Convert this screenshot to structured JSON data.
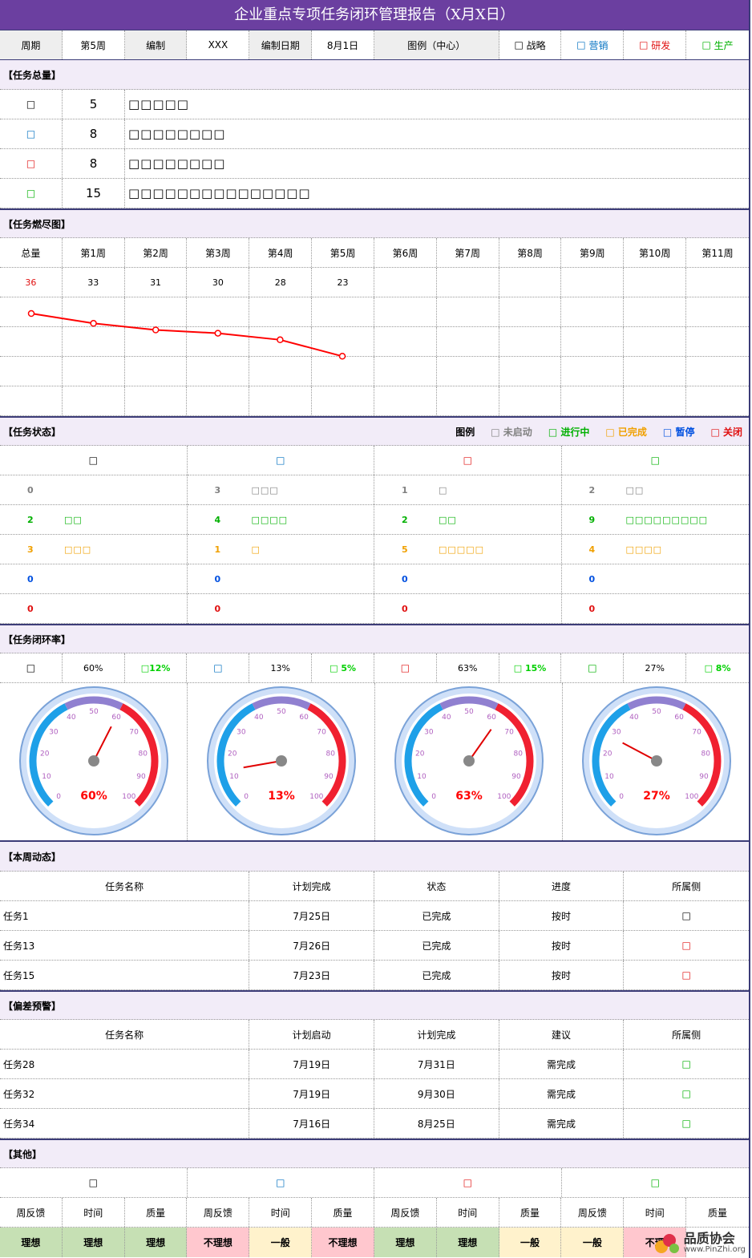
{
  "title": "企业重点专项任务闭环管理报告（X月X日）",
  "header": {
    "period_label": "周期",
    "period_value": "第5周",
    "editor_label": "编制",
    "editor_value": "XXX",
    "date_label": "编制日期",
    "date_value": "8月1日",
    "legend_label": "图例（中心）",
    "legend": [
      {
        "sym": "□",
        "text": "战略",
        "color": "#000000"
      },
      {
        "sym": "□",
        "text": "营销",
        "color": "#0070c0"
      },
      {
        "sym": "□",
        "text": "研发",
        "color": "#e01010"
      },
      {
        "sym": "□",
        "text": "生产",
        "color": "#00b000"
      }
    ]
  },
  "sections": {
    "total": "【任务总量】",
    "burndown": "【任务燃尽图】",
    "status": "【任务状态】",
    "closure": "【任务闭环率】",
    "weekly": "【本周动态】",
    "deviation": "【偏差预警】",
    "other": "【其他】"
  },
  "totals": [
    {
      "sym": "□",
      "count": "5",
      "boxes": "□□□□□"
    },
    {
      "sym": "□",
      "count": "8",
      "boxes": "□□□□□□□□"
    },
    {
      "sym": "□",
      "count": "8",
      "boxes": "□□□□□□□□"
    },
    {
      "sym": "□",
      "count": "15",
      "boxes": "□□□□□□□□□□□□□□□"
    }
  ],
  "burndown": {
    "headers": [
      "总量",
      "第1周",
      "第2周",
      "第3周",
      "第4周",
      "第5周",
      "第6周",
      "第7周",
      "第8周",
      "第9周",
      "第10周",
      "第11周"
    ],
    "values": [
      "36",
      "33",
      "31",
      "30",
      "28",
      "23",
      "",
      "",
      "",
      "",
      "",
      ""
    ]
  },
  "chart_data": {
    "type": "line",
    "x": [
      "总量",
      "第1周",
      "第2周",
      "第3周",
      "第4周",
      "第5周"
    ],
    "series": [
      {
        "values": [
          36,
          33,
          31,
          30,
          28,
          23
        ]
      }
    ],
    "ylim": [
      0,
      40
    ]
  },
  "status": {
    "legend_label": "图例",
    "legend": [
      {
        "sym": "□",
        "text": "未启动"
      },
      {
        "sym": "□",
        "text": "进行中"
      },
      {
        "sym": "□",
        "text": "已完成"
      },
      {
        "sym": "□",
        "text": "暂停"
      },
      {
        "sym": "□",
        "text": "关闭"
      }
    ],
    "columns": [
      {
        "sym": "□",
        "rows": [
          {
            "n": "0",
            "b": ""
          },
          {
            "n": "2",
            "b": "□□"
          },
          {
            "n": "3",
            "b": "□□□"
          },
          {
            "n": "0",
            "b": ""
          },
          {
            "n": "0",
            "b": ""
          }
        ]
      },
      {
        "sym": "□",
        "rows": [
          {
            "n": "3",
            "b": "□□□"
          },
          {
            "n": "4",
            "b": "□□□□"
          },
          {
            "n": "1",
            "b": "□"
          },
          {
            "n": "0",
            "b": ""
          },
          {
            "n": "0",
            "b": ""
          }
        ]
      },
      {
        "sym": "□",
        "rows": [
          {
            "n": "1",
            "b": "□"
          },
          {
            "n": "2",
            "b": "□□"
          },
          {
            "n": "5",
            "b": "□□□□□"
          },
          {
            "n": "0",
            "b": ""
          },
          {
            "n": "0",
            "b": ""
          }
        ]
      },
      {
        "sym": "□",
        "rows": [
          {
            "n": "2",
            "b": "□□"
          },
          {
            "n": "9",
            "b": "□□□□□□□□□"
          },
          {
            "n": "4",
            "b": "□□□□"
          },
          {
            "n": "0",
            "b": ""
          },
          {
            "n": "0",
            "b": ""
          }
        ]
      }
    ]
  },
  "closure": [
    {
      "sym": "□",
      "rate": "60%",
      "delta": "□12%",
      "value": 60
    },
    {
      "sym": "□",
      "rate": "13%",
      "delta": "□ 5%",
      "value": 13
    },
    {
      "sym": "□",
      "rate": "63%",
      "delta": "□ 15%",
      "value": 63
    },
    {
      "sym": "□",
      "rate": "27%",
      "delta": "□ 8%",
      "value": 27
    }
  ],
  "gauge_ticks": [
    "0",
    "10",
    "20",
    "30",
    "40",
    "50",
    "60",
    "70",
    "80",
    "90",
    "100"
  ],
  "weekly": {
    "headers": [
      "任务名称",
      "计划完成",
      "状态",
      "进度",
      "所属侧"
    ],
    "rows": [
      {
        "name": "任务1",
        "date": "7月25日",
        "status": "已完成",
        "progress": "按时",
        "side": "□"
      },
      {
        "name": "任务13",
        "date": "7月26日",
        "status": "已完成",
        "progress": "按时",
        "side": "□"
      },
      {
        "name": "任务15",
        "date": "7月23日",
        "status": "已完成",
        "progress": "按时",
        "side": "□"
      }
    ]
  },
  "deviation": {
    "headers": [
      "任务名称",
      "计划启动",
      "计划完成",
      "建议",
      "所属侧"
    ],
    "rows": [
      {
        "name": "任务28",
        "start": "7月19日",
        "end": "7月31日",
        "advice": "需完成",
        "side": "□"
      },
      {
        "name": "任务32",
        "start": "7月19日",
        "end": "9月30日",
        "advice": "需完成",
        "side": "□"
      },
      {
        "name": "任务34",
        "start": "7月16日",
        "end": "8月25日",
        "advice": "需完成",
        "side": "□"
      }
    ]
  },
  "other": {
    "groups": [
      "□",
      "□",
      "□",
      "□"
    ],
    "headers": [
      "周反馈",
      "时间",
      "质量",
      "周反馈",
      "时间",
      "质量",
      "周反馈",
      "时间",
      "质量",
      "周反馈",
      "时间",
      "质量"
    ],
    "values": [
      "理想",
      "理想",
      "理想",
      "不理想",
      "一般",
      "不理想",
      "理想",
      "理想",
      "一般",
      "一般",
      "不理",
      ""
    ]
  },
  "watermark": {
    "name": "品质协会",
    "url": "www.PinZhi.org"
  }
}
